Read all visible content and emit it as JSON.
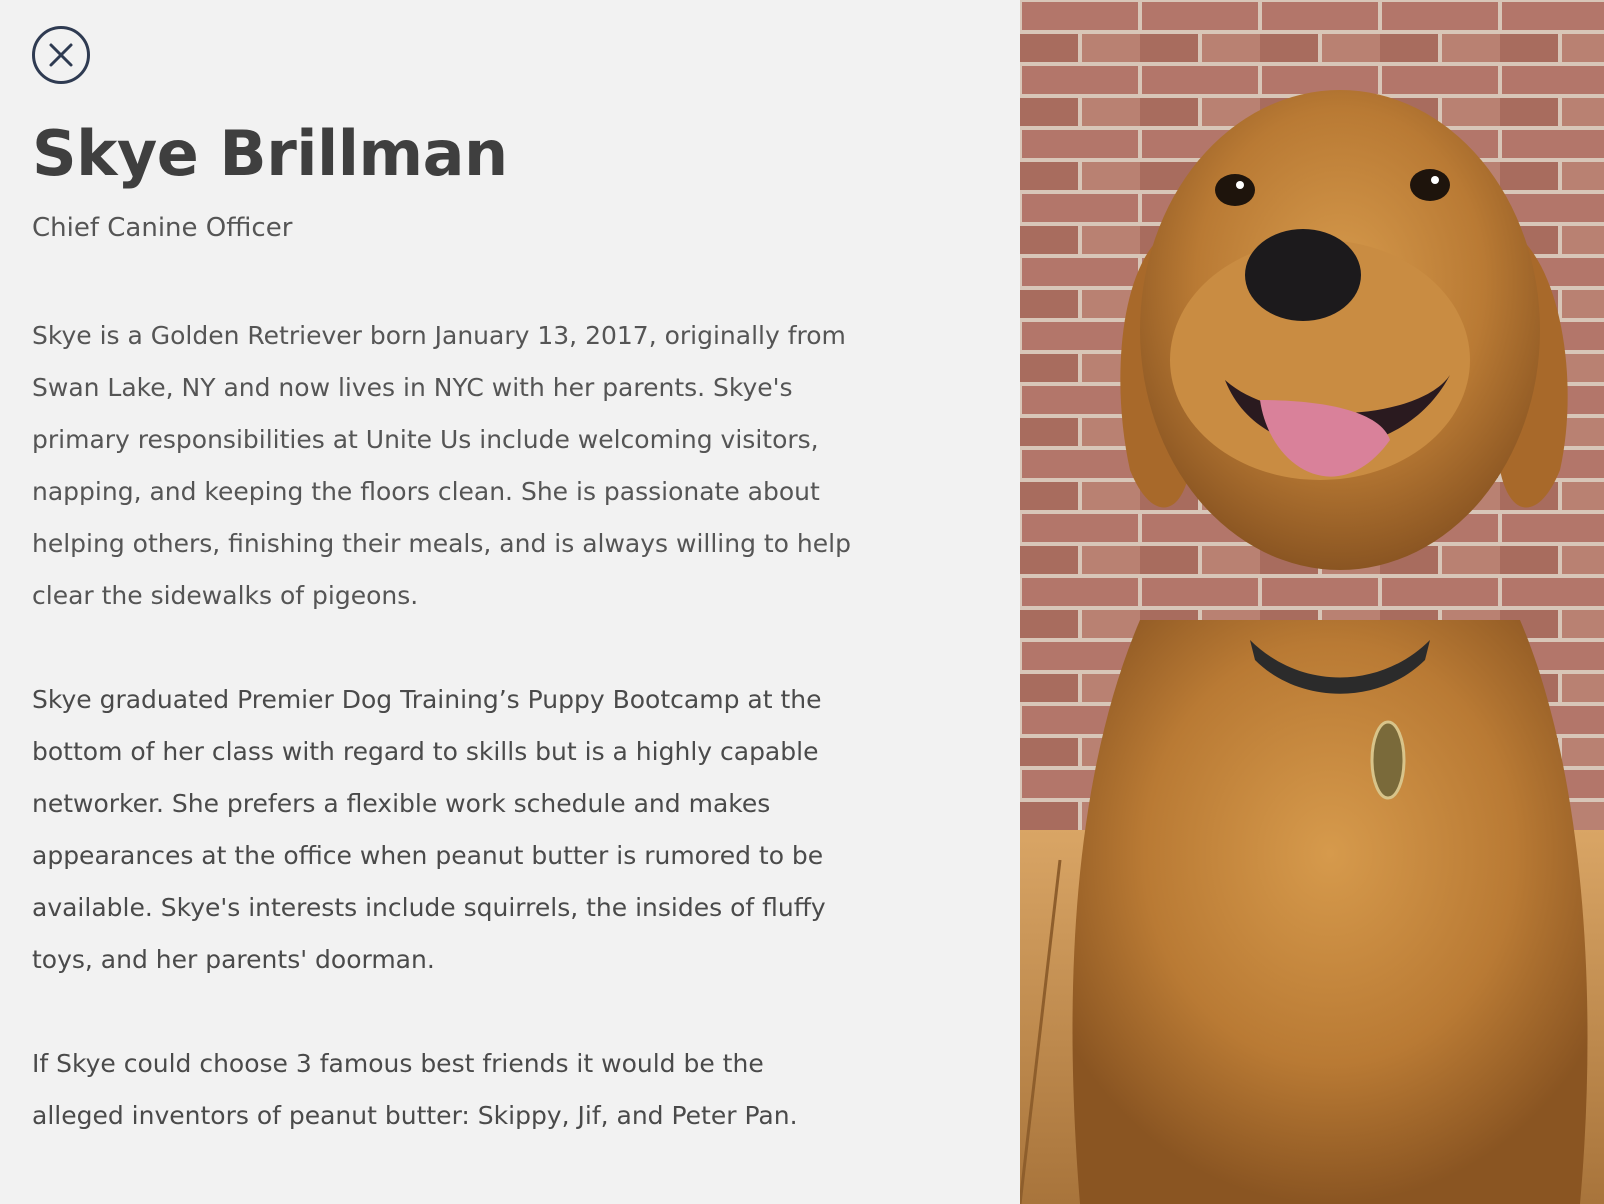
{
  "profile": {
    "name": "Skye Brillman",
    "title": "Chief Canine Officer",
    "bio": [
      "Skye is a Golden Retriever born January 13, 2017, originally from Swan Lake, NY and now lives in NYC with her parents. Skye's primary responsibilities at Unite Us include welcoming visitors, napping, and keeping the floors clean. She is passionate about helping others, finishing their meals, and is always willing to help clear the sidewalks of pigeons.",
      "Skye graduated Premier Dog Training’s Puppy Bootcamp at the bottom of her class with regard to skills but is a highly capable networker. She prefers a flexible work schedule and makes appearances at the office when peanut butter is rumored to be available. Skye's interests include squirrels, the insides of fluffy toys, and her parents' doorman.",
      "If Skye could choose 3 famous best friends it would be the alleged inventors of peanut butter: Skippy, Jif, and Peter Pan."
    ]
  },
  "close": {
    "icon": "close-icon",
    "aria_label": "Close"
  },
  "photo": {
    "alt": "Golden Retriever sitting in front of a brick wall",
    "colors": {
      "brick": "#b07a68",
      "mortar": "#d9c9bd",
      "floor": "#c9924f",
      "fur": "#c2863d"
    }
  },
  "colors": {
    "background": "#f2f2f2",
    "heading": "#3f3f3f",
    "body_text": "#4a4a4a",
    "close_icon": "#2f3b52"
  }
}
